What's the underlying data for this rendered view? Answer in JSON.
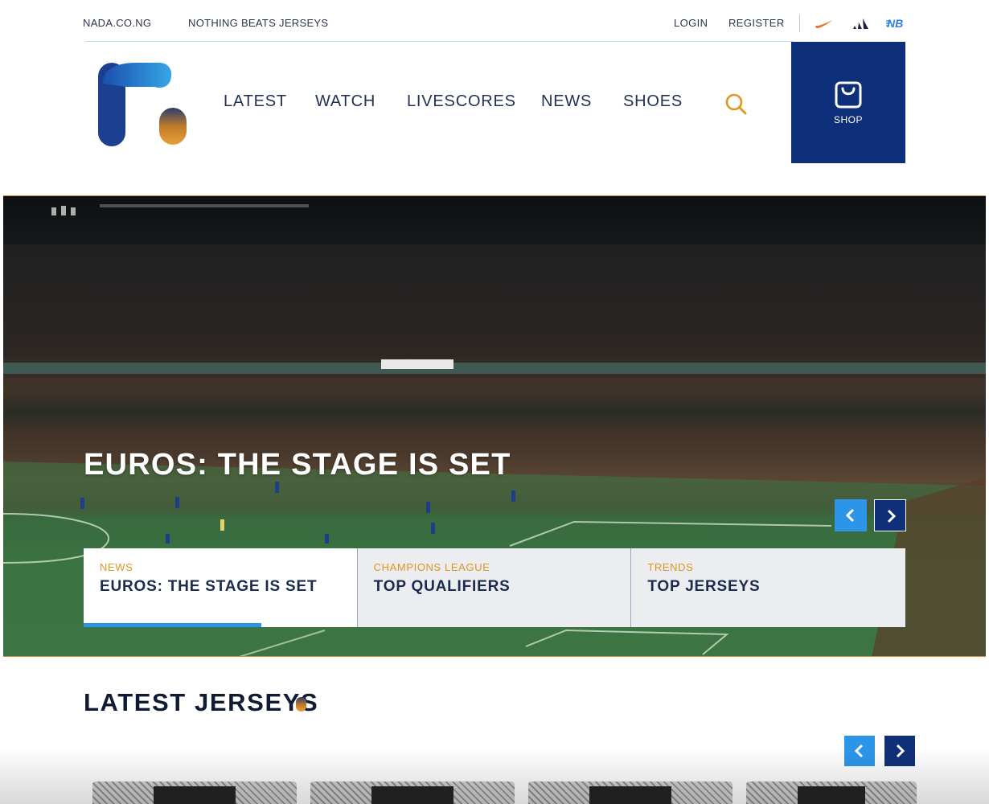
{
  "topbar": {
    "site": "NADA.CO.NG",
    "tagline": "NOTHING BEATS JERSEYS",
    "login": "LOGIN",
    "register": "REGISTER",
    "brands": [
      "nike-icon",
      "adidas-icon",
      "new-balance-icon"
    ]
  },
  "header": {
    "logo": "nada-logo",
    "nav": [
      "LATEST",
      "WATCH",
      "LIVESCORES",
      "NEWS",
      "SHOES"
    ],
    "search_icon": "search-icon",
    "shop_label": "SHOP",
    "shop_icon": "shopping-bag-icon"
  },
  "hero": {
    "title": "EUROS: THE STAGE IS SET",
    "cards": [
      {
        "category": "NEWS",
        "title": "EUROS: THE STAGE IS SET",
        "progress": 0.65
      },
      {
        "category": "CHAMPIONS LEAGUE",
        "title": "TOP QUALIFIERS"
      },
      {
        "category": "TRENDS",
        "title": "TOP JERSEYS"
      }
    ]
  },
  "latest": {
    "title": "LATEST JERSEYS"
  },
  "colors": {
    "navy": "#0d2e78",
    "accent_blue": "#2d95e8",
    "accent_orange": "#e0951f",
    "text_dark": "#1c2a4e"
  }
}
